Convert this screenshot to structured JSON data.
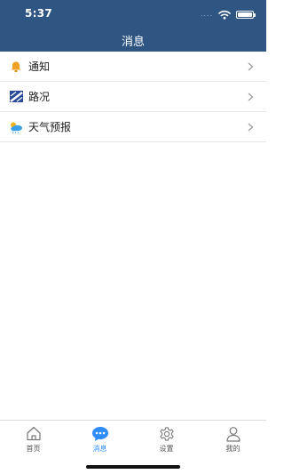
{
  "status_bar": {
    "time": "5:37",
    "signal": "....",
    "icons": [
      "wifi-icon",
      "battery-icon"
    ]
  },
  "header": {
    "title": "消息",
    "background": "#2f5583"
  },
  "messages": [
    {
      "label": "通知",
      "icon": "bell-icon",
      "color": "#f0a020"
    },
    {
      "label": "路况",
      "icon": "road-icon",
      "color": "#2a4a9a"
    },
    {
      "label": "天气预报",
      "icon": "weather-icon",
      "color": "#3aa0e8"
    }
  ],
  "tabbar": {
    "active_color": "#2f8cff",
    "tabs": [
      {
        "label": "首页",
        "icon": "home-icon",
        "active": false
      },
      {
        "label": "消息",
        "icon": "message-icon",
        "active": true
      },
      {
        "label": "设置",
        "icon": "gear-icon",
        "active": false
      },
      {
        "label": "我的",
        "icon": "user-icon",
        "active": false
      }
    ]
  }
}
